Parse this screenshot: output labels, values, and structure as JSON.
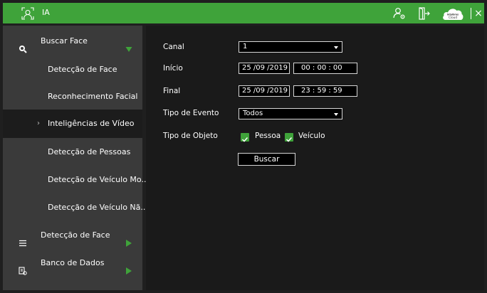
{
  "topbar": {
    "title": "IA",
    "cloud_label_top": "intelbras",
    "cloud_label": "Cloud",
    "close_glyph": "×",
    "icons": [
      "face-recognition-icon",
      "user-settings-icon",
      "logout-icon",
      "cloud-icon",
      "close-icon"
    ],
    "accent_color": "#3fa33a"
  },
  "sidebar": {
    "items": [
      {
        "label": "Buscar Face",
        "icon": "face-search-icon",
        "expanded": true
      },
      {
        "label": "Detecção de Face"
      },
      {
        "label": "Reconhecimento Facial"
      },
      {
        "label": "Inteligências de Vídeo",
        "active": true,
        "chevron": "›"
      },
      {
        "label": "Detecção de Pessoas"
      },
      {
        "label": "Detecção de Veículo Mo..."
      },
      {
        "label": "Detecção de Veículo Nã..."
      },
      {
        "label": "Detecção de Face",
        "icon": "list-icon",
        "expanded": false
      },
      {
        "label": "Banco de Dados",
        "icon": "database-icon",
        "expanded": false
      }
    ]
  },
  "form": {
    "canal": {
      "label": "Canal",
      "value": "1"
    },
    "inicio": {
      "label": "Início",
      "date": "25 /09 /2019",
      "time": "00 : 00 : 00"
    },
    "final": {
      "label": "Final",
      "date": "25 /09 /2019",
      "time": "23 : 59 : 59"
    },
    "tipo_evento": {
      "label": "Tipo de Evento",
      "value": "Todos"
    },
    "tipo_objeto": {
      "label": "Tipo de Objeto",
      "pessoa": {
        "label": "Pessoa",
        "checked": true
      },
      "veiculo": {
        "label": "Veículo",
        "checked": true
      }
    },
    "buscar_label": "Buscar"
  }
}
